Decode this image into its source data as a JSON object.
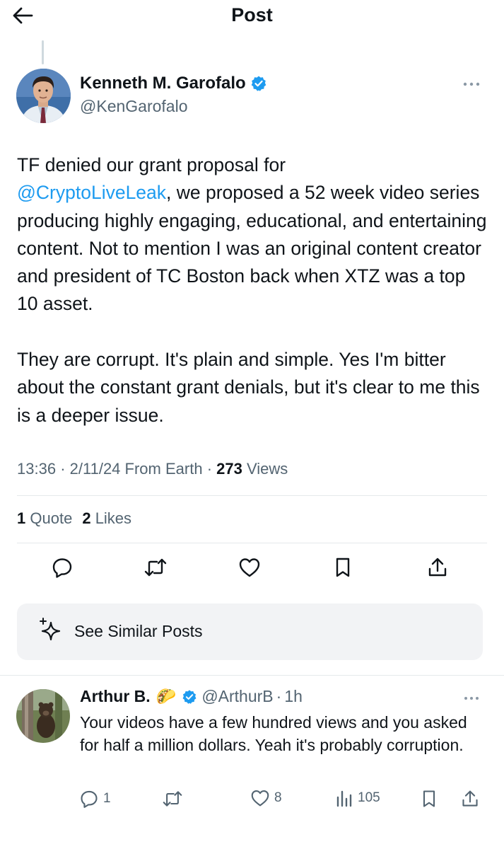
{
  "header": {
    "title": "Post"
  },
  "author": {
    "name": "Kenneth M. Garofalo",
    "handle": "@KenGarofalo"
  },
  "post": {
    "text_before": "TF denied our grant proposal for\n",
    "mention": "@CryptoLiveLeak",
    "text_after": ", we proposed a 52 week video series producing highly engaging, educational, and entertaining content. Not to mention I was an original content creator and president of TC Boston back when XTZ was a top 10 asset.\n\nThey are corrupt. It's plain and simple. Yes I'm bitter about the constant grant denials, but it's clear to me this is a deeper issue.",
    "time": "13:36",
    "date": "2/11/24",
    "location": "From Earth",
    "views_count": "273",
    "views_label": "Views",
    "sep": "·"
  },
  "engagement": {
    "quotes_count": "1",
    "quotes_label": "Quote",
    "likes_count": "2",
    "likes_label": "Likes"
  },
  "actions": {
    "icons": [
      "reply-icon",
      "repost-icon",
      "like-icon",
      "bookmark-icon",
      "share-icon"
    ]
  },
  "similar": {
    "label": "See Similar Posts"
  },
  "reply": {
    "name": "Arthur B.",
    "emoji": "🌮",
    "handle": "@ArthurB",
    "sep": "·",
    "time": "1h",
    "text": "Your videos have a few hundred views and you asked for half a million dollars. Yeah it's probably corruption.",
    "reply_count": "1",
    "like_count": "8",
    "view_count": "105"
  },
  "colors": {
    "accent": "#1d9bf0",
    "verified": "#1d9bf0",
    "muted": "#536471",
    "text": "#0f1419"
  }
}
